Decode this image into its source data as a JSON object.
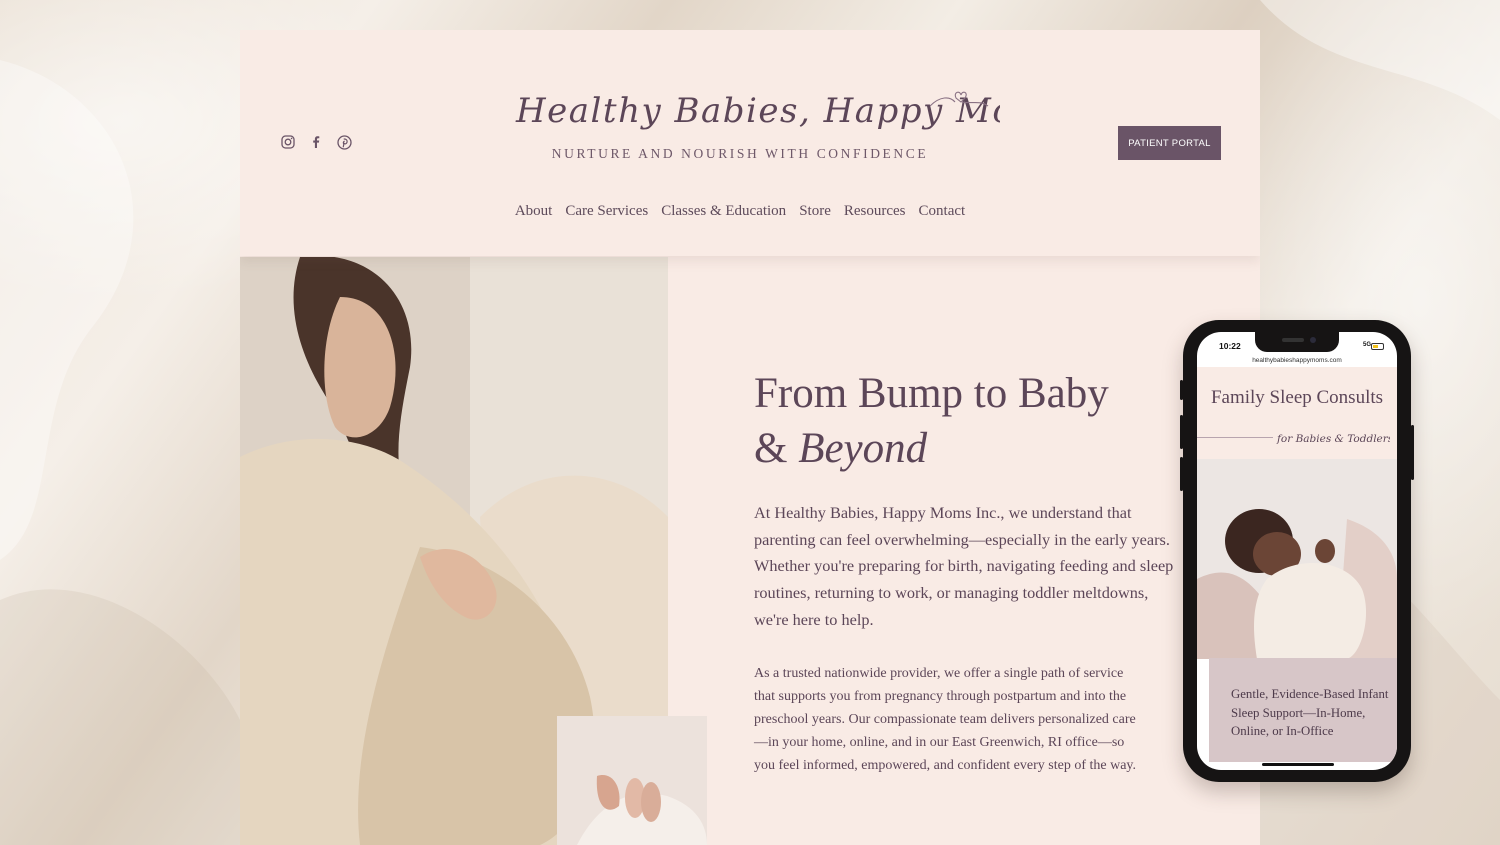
{
  "header": {
    "logo_text": "Healthy Babies, Happy Moms",
    "tagline": "NURTURE AND NOURISH WITH CONFIDENCE",
    "portal_button": "PATIENT PORTAL",
    "social_icons": [
      "instagram-icon",
      "facebook-icon",
      "pinterest-icon"
    ]
  },
  "nav": {
    "items": [
      {
        "label": "About"
      },
      {
        "label": "Care Services"
      },
      {
        "label": "Classes & Education"
      },
      {
        "label": "Store"
      },
      {
        "label": "Resources"
      },
      {
        "label": "Contact"
      }
    ]
  },
  "hero": {
    "title_line1": "From Bump to Baby",
    "title_amp": "&",
    "title_italic": "Beyond",
    "intro": "At Healthy Babies, Happy Moms Inc., we understand that parenting can feel overwhelming—especially in the early years. Whether you're preparing for birth, navigating feeding and sleep routines, returning to work, or managing toddler meltdowns, we're here to help.",
    "body": "As a trusted nationwide provider, we offer a single path of service that supports you from pregnancy through postpartum and into the preschool years. Our compassionate team delivers personalized care—in your home, online, and in our East Greenwich, RI office—so you feel informed, empowered, and confident every step of the way."
  },
  "phone": {
    "time": "10:22",
    "signal": "5G",
    "url": "healthybabieshappymoms.com",
    "title": "Family Sleep Consults",
    "script_subtitle": "for Babies & Toddlers",
    "card_text": "Gentle, Evidence-Based Infant Sleep Support—In-Home, Online, or In-Office"
  },
  "colors": {
    "page_bg": "#f9ebe5",
    "accent_plum": "#6a5467",
    "text_plum": "#5c4658",
    "card_mauve": "#d7c6c8"
  }
}
